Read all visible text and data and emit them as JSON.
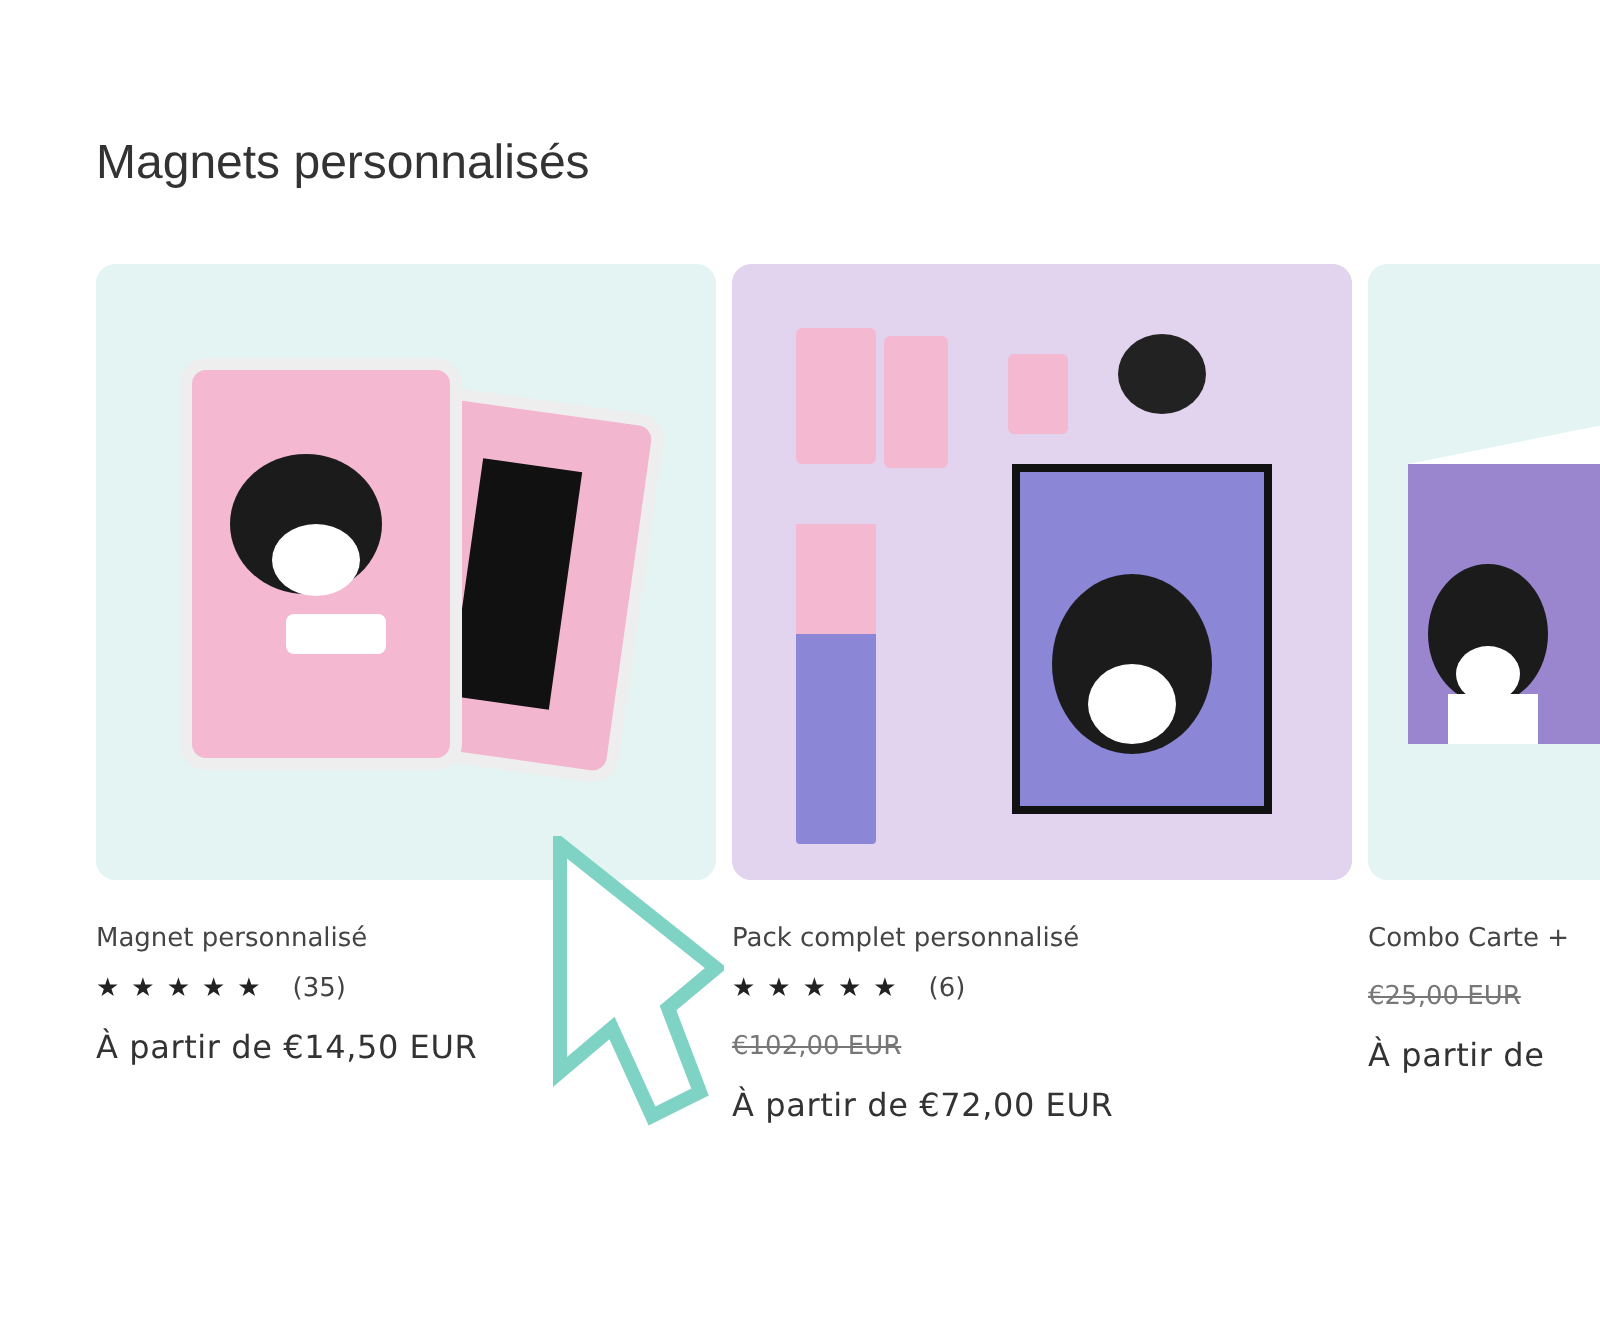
{
  "section_title": "Magnets personnalisés",
  "products": [
    {
      "kind": "picture",
      "name": "Magnet personnalisé",
      "stars": 5,
      "reviews": "(35)",
      "price": "À partir de €14,50 EUR"
    },
    {
      "kind": "picture",
      "name": "Pack complet personnalisé",
      "stars": 5,
      "reviews": "(6)",
      "old_price": "€102,00 EUR",
      "price": "À partir de €72,00 EUR"
    },
    {
      "kind": "picture",
      "name": "Combo Carte +",
      "old_price": "€25,00 EUR",
      "price": "À partir de"
    }
  ]
}
